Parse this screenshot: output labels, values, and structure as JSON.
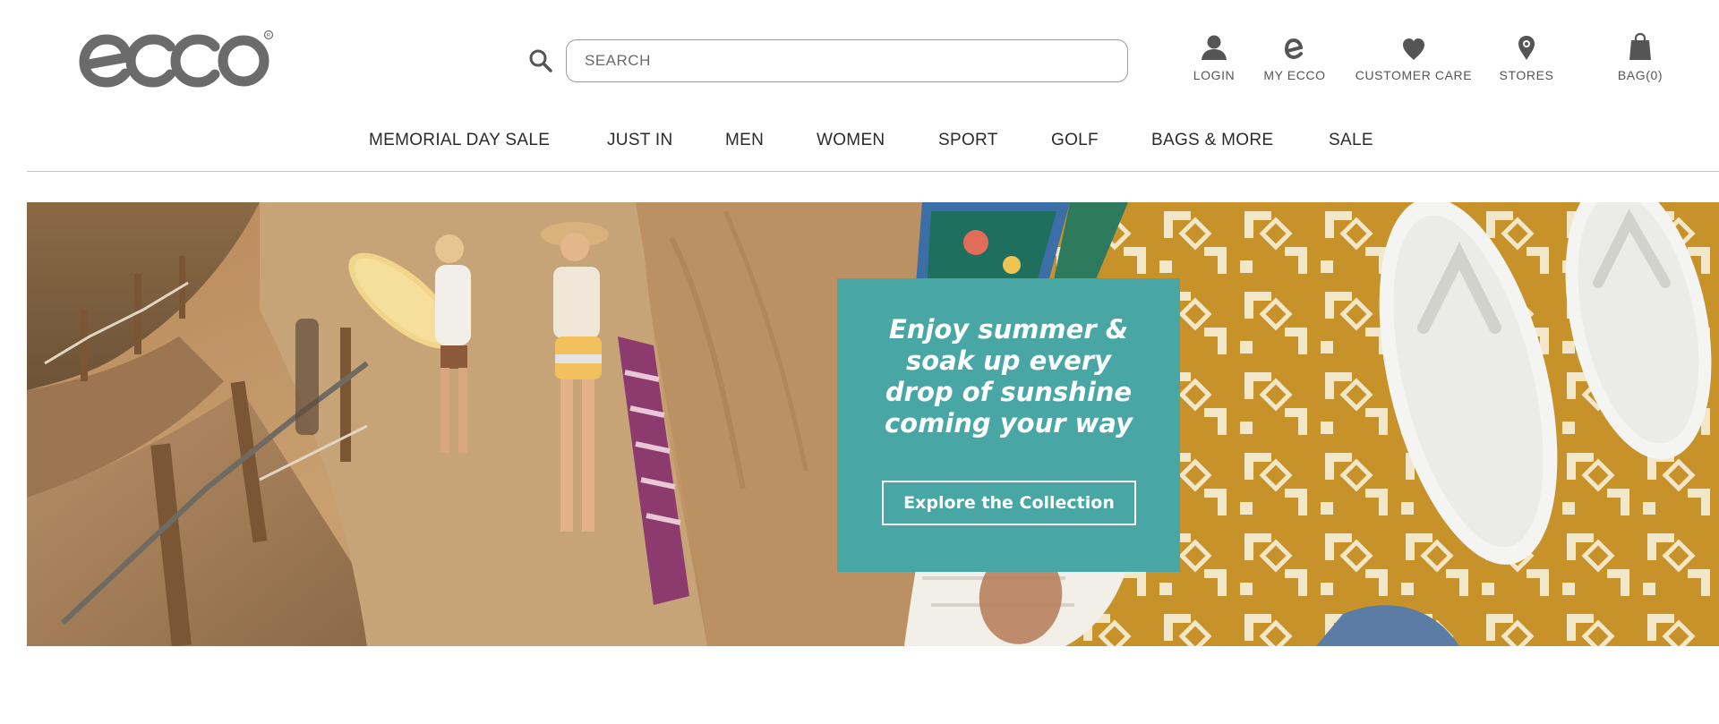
{
  "header": {
    "logo_text": "ecco",
    "search": {
      "placeholder": "SEARCH",
      "value": ""
    },
    "utility_links": [
      {
        "label": "LOGIN",
        "icon": "user-icon"
      },
      {
        "label": "MY ECCO",
        "icon": "ecco-e-icon"
      },
      {
        "label": "CUSTOMER CARE",
        "icon": "heart-icon"
      },
      {
        "label": "STORES",
        "icon": "map-pin-icon"
      },
      {
        "label": "BAG(0)",
        "icon": "shopping-bag-icon"
      }
    ]
  },
  "main_nav": {
    "items": [
      {
        "label": "MEMORIAL DAY SALE"
      },
      {
        "label": "JUST IN"
      },
      {
        "label": "MEN"
      },
      {
        "label": "WOMEN"
      },
      {
        "label": "SPORT"
      },
      {
        "label": "GOLF"
      },
      {
        "label": "BAGS & MORE"
      },
      {
        "label": "SALE"
      }
    ]
  },
  "hero": {
    "heading": "Enjoy summer & soak up every drop of sunshine coming your way",
    "button_label": "Explore the Collection",
    "promo_color": "#48a7a5"
  },
  "colors": {
    "text": "#2b2b2b",
    "logo": "#6b6b6b",
    "promo": "#48a7a5",
    "rug_gold": "#c8922a"
  }
}
